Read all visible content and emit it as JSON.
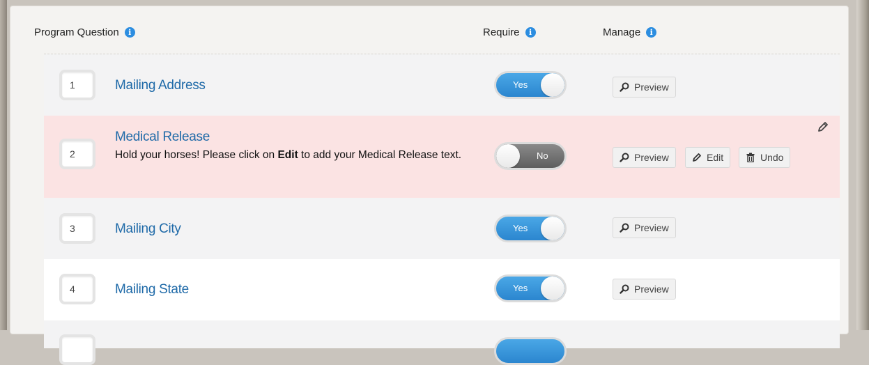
{
  "header": {
    "program_question": "Program Question",
    "require": "Require",
    "manage": "Manage",
    "info_glyph": "i"
  },
  "rows": [
    {
      "number": "1",
      "title": "Mailing Address",
      "toggle": "Yes",
      "buttons": [
        "Preview"
      ]
    },
    {
      "number": "2",
      "title": "Medical Release",
      "message_before": "Hold your horses! Please click on ",
      "message_bold": "Edit",
      "message_after": " to add your Medical Release text.",
      "toggle": "No",
      "buttons": [
        "Preview",
        "Edit",
        "Undo"
      ]
    },
    {
      "number": "3",
      "title": "Mailing City",
      "toggle": "Yes",
      "buttons": [
        "Preview"
      ]
    },
    {
      "number": "4",
      "title": "Mailing State",
      "toggle": "Yes",
      "buttons": [
        "Preview"
      ]
    }
  ],
  "colors": {
    "accent": "#2c8de0",
    "link": "#1f6aa8",
    "alert_row": "#fbe3e3"
  },
  "icons": [
    "info-icon",
    "search-icon",
    "pencil-icon",
    "trash-icon"
  ]
}
